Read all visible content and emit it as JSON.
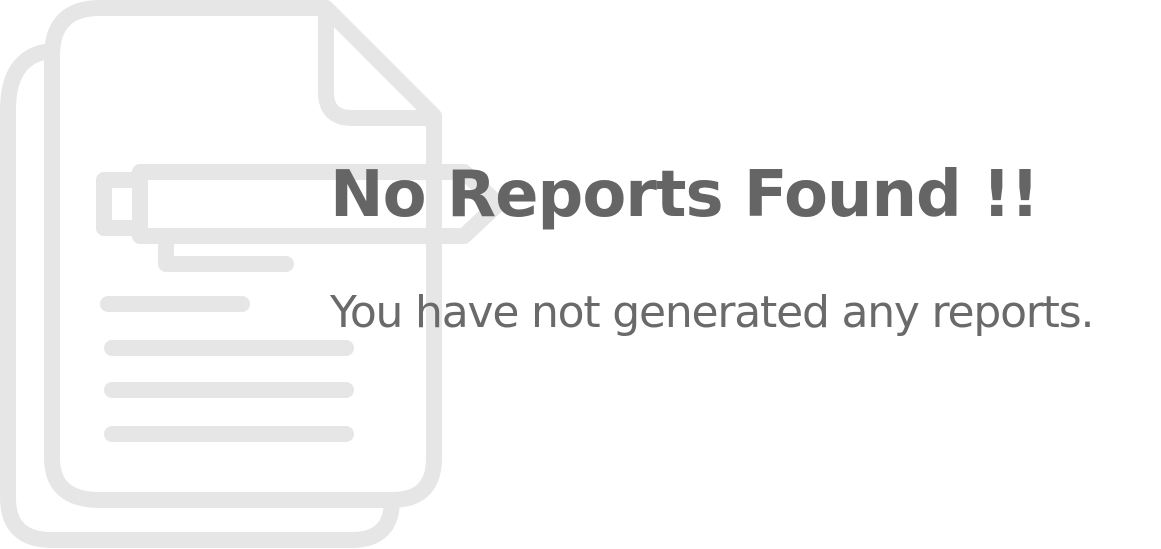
{
  "empty_state": {
    "title": "No Reports Found !!",
    "message": "You have not generated any reports.",
    "illustration_icon": "document-pen-icon"
  },
  "colors": {
    "background": "#ffffff",
    "illustration": "#e6e6e6",
    "title": "#656565",
    "message": "#6a6a6a"
  }
}
